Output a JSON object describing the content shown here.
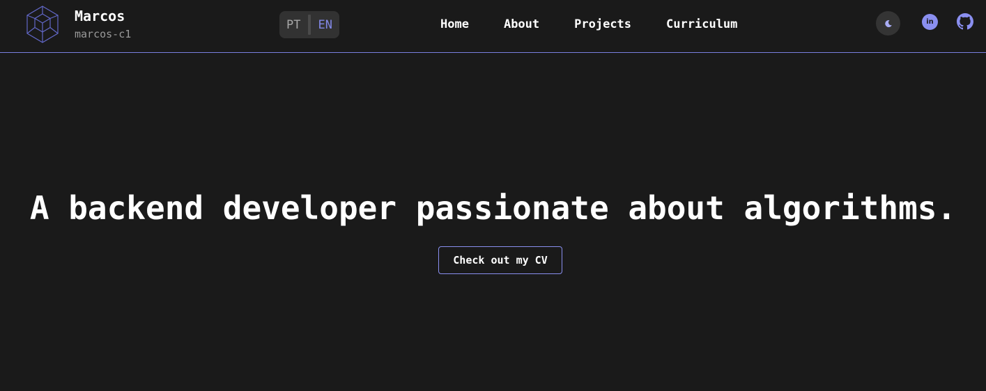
{
  "brand": {
    "name": "Marcos",
    "handle": "marcos-c1",
    "logo_icon": "cube-wireframe-icon"
  },
  "language": {
    "options": [
      "PT",
      "EN"
    ],
    "selected": "EN"
  },
  "nav": {
    "items": [
      {
        "label": "Home"
      },
      {
        "label": "About"
      },
      {
        "label": "Projects"
      },
      {
        "label": "Curriculum"
      }
    ]
  },
  "social": {
    "theme_icon": "moon-icon",
    "linkedin_icon": "linkedin-icon",
    "linkedin_text": "in",
    "github_icon": "github-icon"
  },
  "hero": {
    "title": "A backend developer passionate about algorithms.",
    "cta_label": "Check out my CV"
  },
  "colors": {
    "background": "#1a1a1a",
    "accent": "#8a8ff0",
    "text": "#ffffff",
    "muted": "#9a9a9a"
  }
}
